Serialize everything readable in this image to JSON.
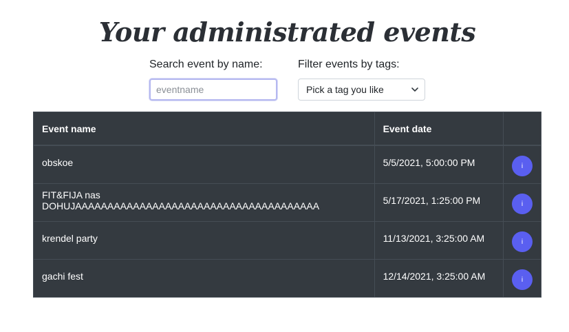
{
  "header": {
    "title": "Your administrated events"
  },
  "filters": {
    "search_label": "Search event by name:",
    "search_placeholder": "eventname",
    "tags_label": "Filter events by tags:",
    "tags_selected": "Pick a tag you like"
  },
  "table": {
    "columns": [
      "Event name",
      "Event date",
      ""
    ],
    "rows": [
      {
        "name": "obskoe",
        "date": "5/5/2021, 5:00:00 PM",
        "action": "i"
      },
      {
        "name": "FIT&FIJA nas DOHUJAAAAAAAAAAAAAAAAAAAAAAAAAAAAAAAAAAAAAA",
        "date": "5/17/2021, 1:25:00 PM",
        "action": "i"
      },
      {
        "name": "krendel party",
        "date": "11/13/2021, 3:25:00 AM",
        "action": "i"
      },
      {
        "name": "gachi fest",
        "date": "12/14/2021, 3:25:00 AM",
        "action": "i"
      }
    ]
  },
  "colors": {
    "table_bg": "#343a40",
    "accent": "#5a5ff0"
  }
}
